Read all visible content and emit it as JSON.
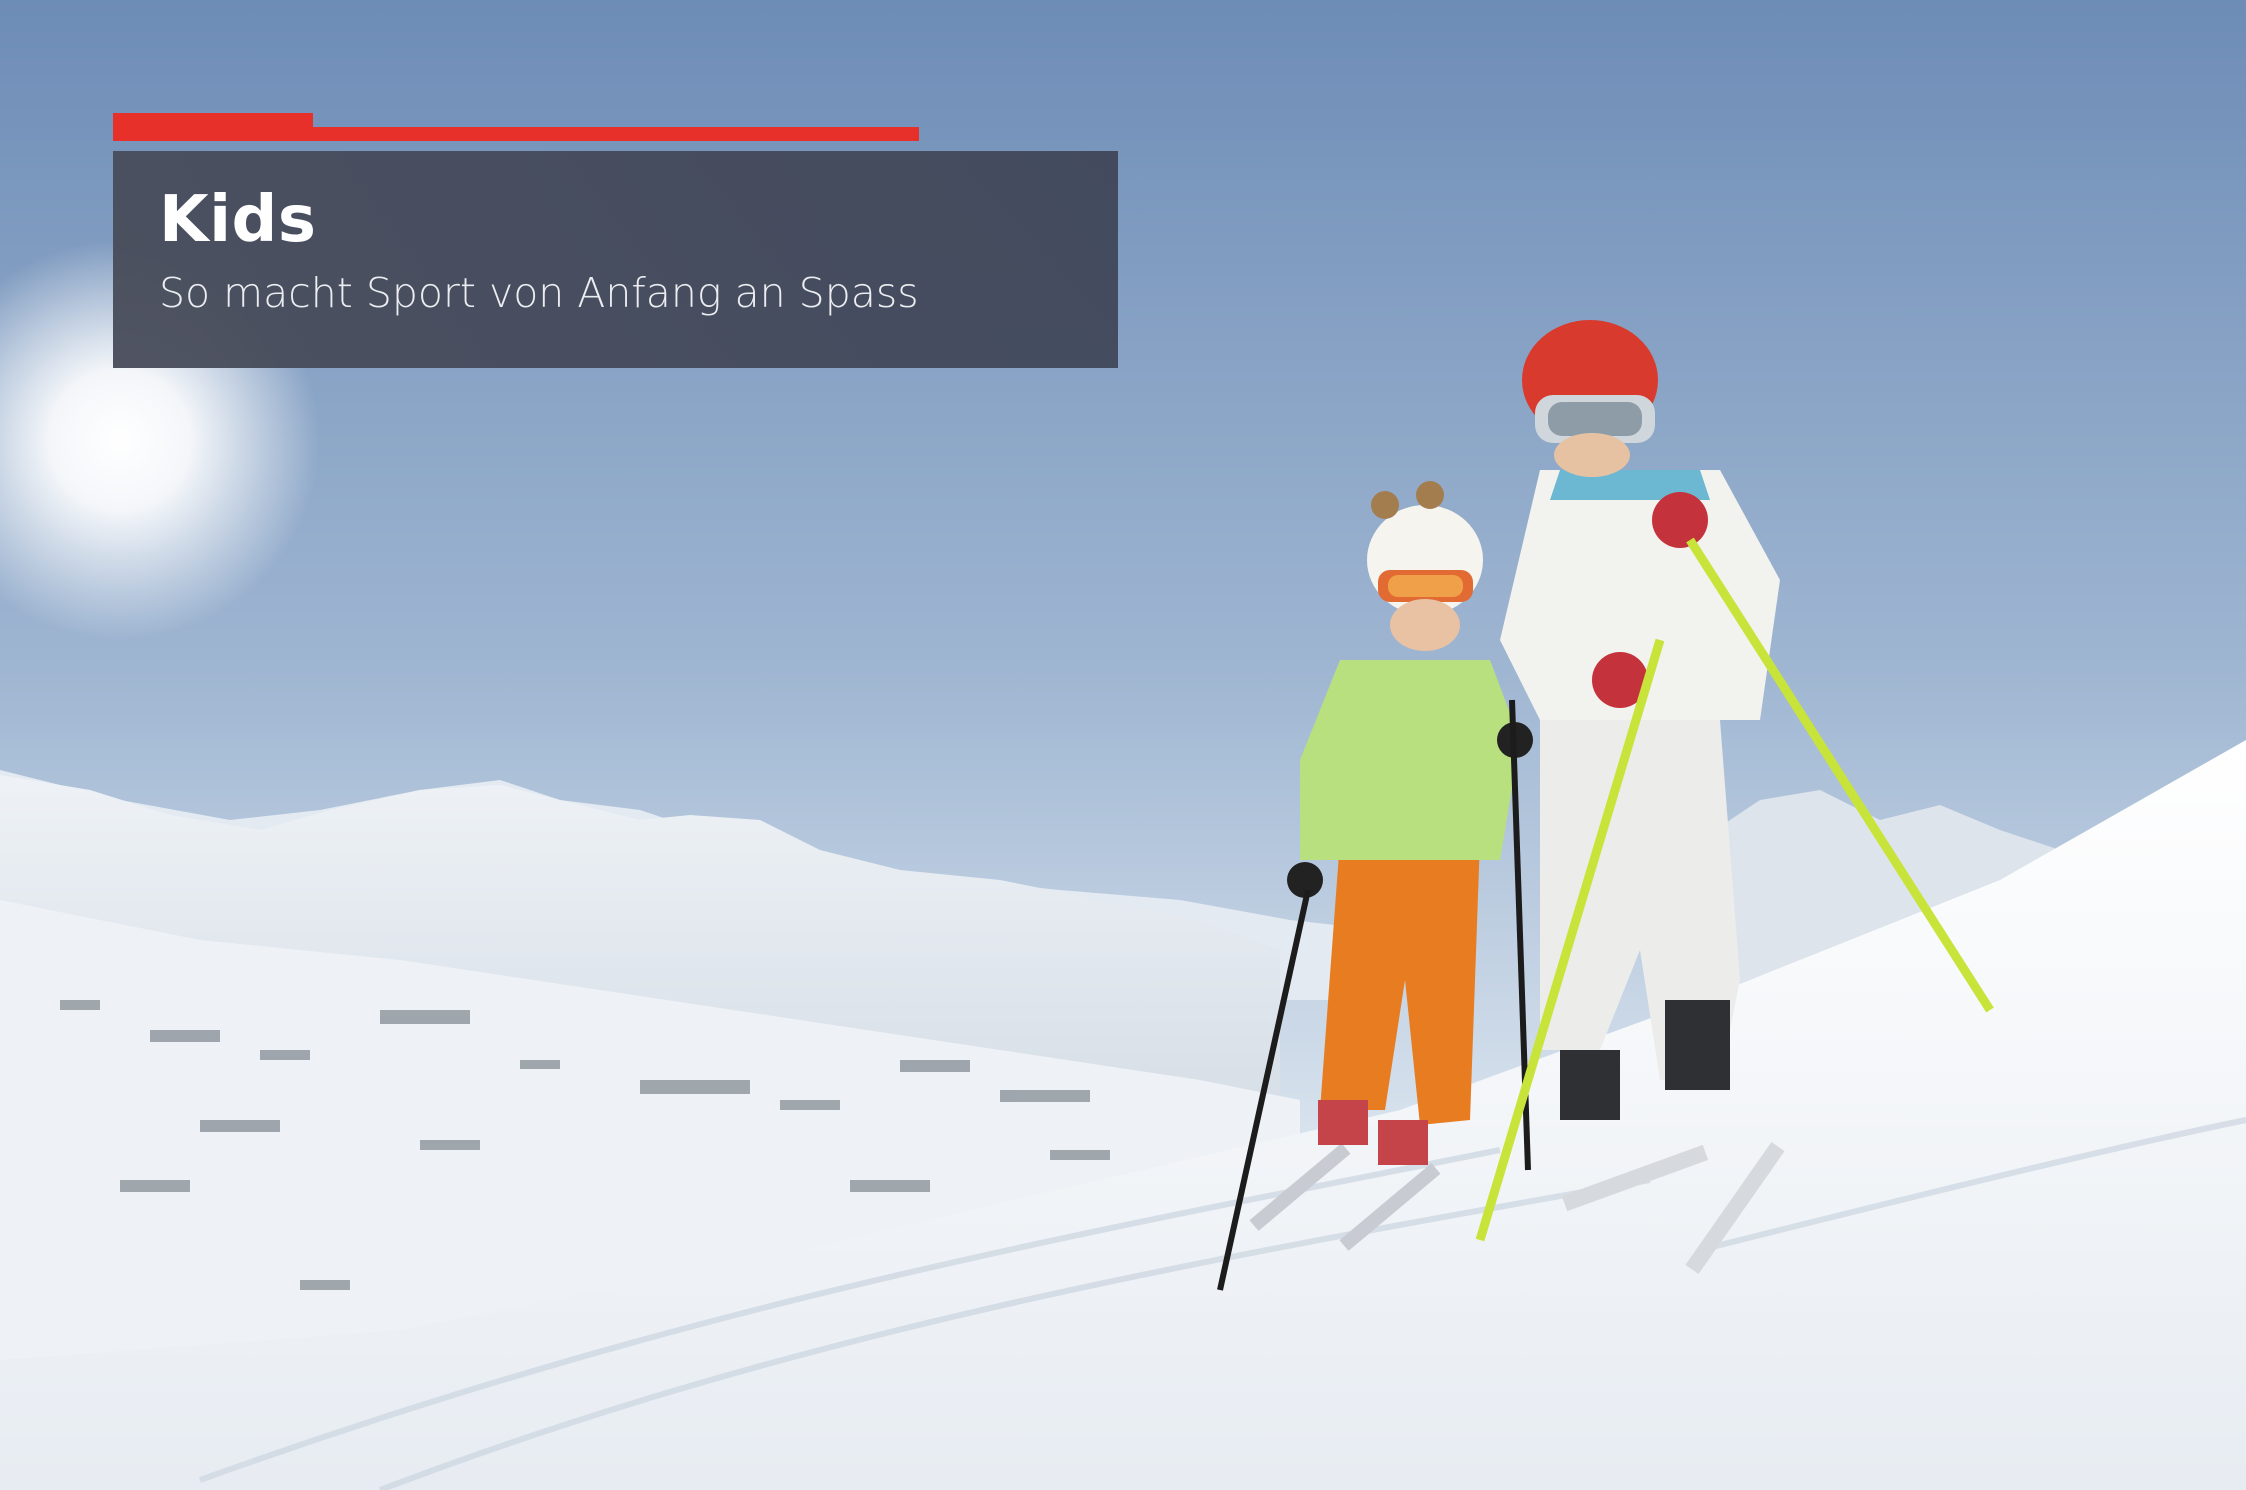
{
  "header": {
    "title": "Kids",
    "subtitle": "So macht Sport von Anfang an Spass"
  },
  "colors": {
    "accent": "#e8302a",
    "title_box": "#4a4f5f",
    "sky": "#7a97bb",
    "snow": "#f4f6f9"
  },
  "photo": {
    "subject": "two children on skis on a snowy mountain slope",
    "icon": "photo-icon"
  }
}
